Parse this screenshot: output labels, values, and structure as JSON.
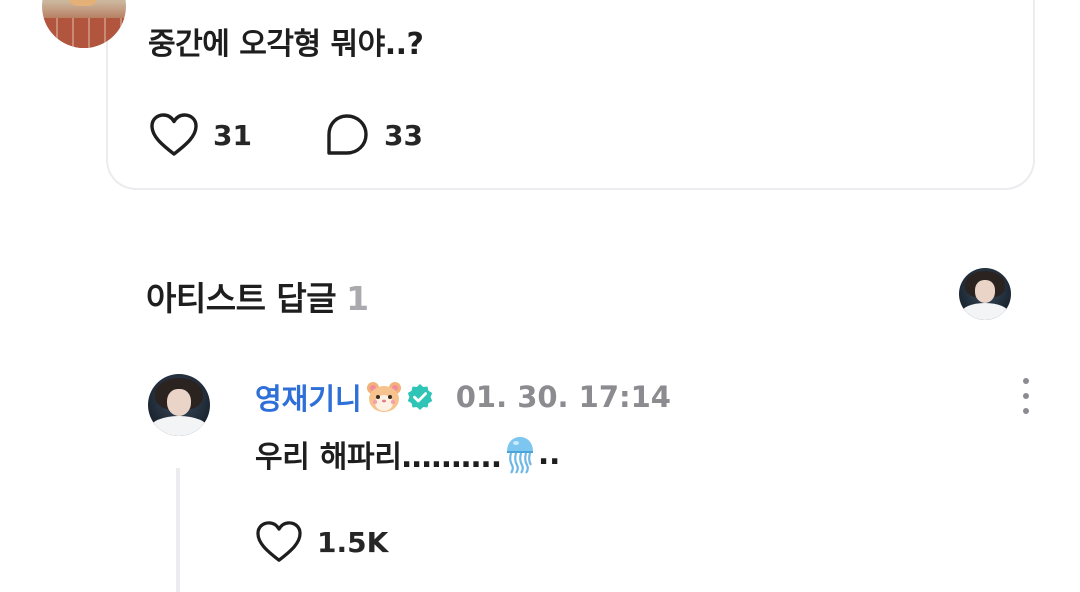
{
  "post": {
    "text": "중간에 오각형 뭐야..?",
    "likes": "31",
    "comments": "33"
  },
  "artist_replies": {
    "title": "아티스트 답글",
    "count": "1"
  },
  "reply": {
    "author": "영재기니",
    "badge_emoji": "hamster-face",
    "verified": true,
    "timestamp": "01. 30. 17:14",
    "text_before": "우리 해파리……….",
    "emoji": "jellyfish",
    "text_after": "..",
    "likes": "1.5K"
  },
  "colors": {
    "author_name": "#2f6fd8",
    "verified_badge": "#2ec4b6",
    "muted": "#8b8b90"
  }
}
